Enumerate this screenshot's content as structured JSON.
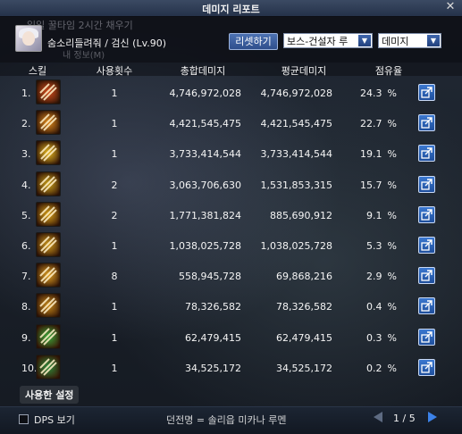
{
  "window": {
    "title": "데미지 리포트",
    "close_glyph": "✕"
  },
  "header": {
    "character_name": "숨소리들려줘 / 검신 (Lv.90)",
    "reset_label": "리셋하기",
    "boss_select": "보스-건설자 루",
    "metric_select": "데미지",
    "bg_text_top": "일일 꿀타임 2시간 채우기",
    "bg_text_sub": "내 정보(M)"
  },
  "columns": {
    "skill": "스킬",
    "uses": "사용횟수",
    "total": "총합데미지",
    "avg": "평균데미지",
    "share": "점유율"
  },
  "rows": [
    {
      "rank": "1.",
      "uses": "1",
      "total": "4,746,972,028",
      "avg": "4,746,972,028",
      "share": "24.3",
      "pct": "%",
      "icon": "burst-skill-icon",
      "color": "#d34a1a"
    },
    {
      "rank": "2.",
      "uses": "1",
      "total": "4,421,545,475",
      "avg": "4,421,545,475",
      "share": "22.7",
      "pct": "%",
      "icon": "flame-slash-icon",
      "color": "#e08a1a"
    },
    {
      "rank": "3.",
      "uses": "1",
      "total": "3,733,414,544",
      "avg": "3,733,414,544",
      "share": "19.1",
      "pct": "%",
      "icon": "sword-flash-icon",
      "color": "#e6b81e"
    },
    {
      "rank": "4.",
      "uses": "2",
      "total": "3,063,706,630",
      "avg": "1,531,853,315",
      "share": "15.7",
      "pct": "%",
      "icon": "ring-slash-icon",
      "color": "#c9a018"
    },
    {
      "rank": "5.",
      "uses": "2",
      "total": "1,771,381,824",
      "avg": "885,690,912",
      "share": "9.1",
      "pct": "%",
      "icon": "moon-blade-icon",
      "color": "#d9a116"
    },
    {
      "rank": "6.",
      "uses": "1",
      "total": "1,038,025,728",
      "avg": "1,038,025,728",
      "share": "5.3",
      "pct": "%",
      "icon": "flow-glyph-icon",
      "color": "#cf9a1a"
    },
    {
      "rank": "7.",
      "uses": "8",
      "total": "558,945,728",
      "avg": "69,868,216",
      "share": "2.9",
      "pct": "%",
      "icon": "twin-blade-icon",
      "color": "#e0a020"
    },
    {
      "rank": "8.",
      "uses": "1",
      "total": "78,326,582",
      "avg": "78,326,582",
      "share": "0.4",
      "pct": "%",
      "icon": "thrust-icon",
      "color": "#c88a18"
    },
    {
      "rank": "9.",
      "uses": "1",
      "total": "62,479,415",
      "avg": "62,479,415",
      "share": "0.3",
      "pct": "%",
      "icon": "green-cut-icon",
      "color": "#3aa83a"
    },
    {
      "rank": "10.",
      "uses": "1",
      "total": "34,525,172",
      "avg": "34,525,172",
      "share": "0.2",
      "pct": "%",
      "icon": "green-strike-icon",
      "color": "#2c8a3a"
    }
  ],
  "footer": {
    "save_label": "사용한 설정",
    "dps_label": "DPS 보기",
    "dungeon_text": "던전명 = 솔리읍 미카나 루멘",
    "page_current": "1",
    "page_separator": "/",
    "page_total": "5"
  },
  "colors": {
    "accent": "#3c82e8",
    "title_bar": "#2e3d58"
  }
}
